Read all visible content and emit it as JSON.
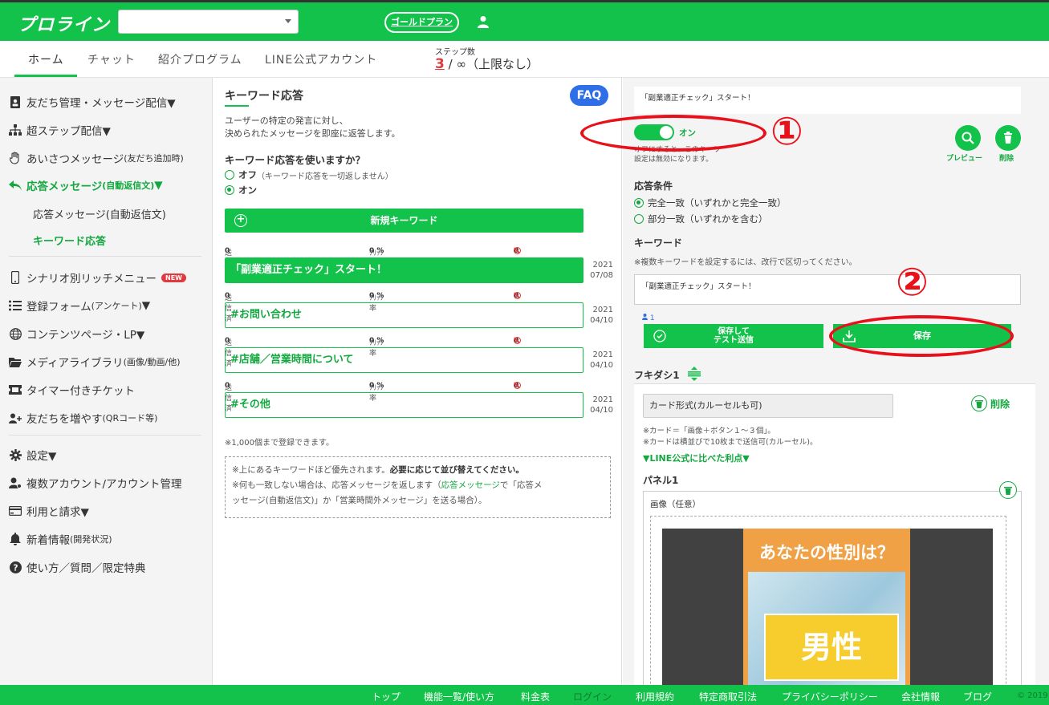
{
  "header": {
    "logo": "プロライン",
    "account_select_value": "",
    "plan_badge": "ゴールドプラン",
    "user_icon": "user-icon"
  },
  "nav": {
    "tabs": [
      "ホーム",
      "チャット",
      "紹介プログラム",
      "LINE公式アカウント"
    ],
    "active_tab": "ホーム",
    "steps_label": "ステップ数",
    "steps_current": "3",
    "steps_rest": "/ ∞（上限なし）"
  },
  "sidebar": {
    "items": [
      {
        "label": "友だち管理・メッセージ配信▼",
        "icon": "address-book-icon"
      },
      {
        "label": "超ステップ配信▼",
        "icon": "sitemap-icon"
      },
      {
        "label": "あいさつメッセージ",
        "small": "(友だち追加時)",
        "icon": "hand-icon"
      },
      {
        "label": "応答メッセージ",
        "small": "(自動返信文)",
        "suffix": "▼",
        "icon": "reply-icon"
      },
      {
        "label": "シナリオ別リッチメニュー",
        "badge": "NEW",
        "icon": "phone-icon"
      },
      {
        "label": "登録フォーム",
        "small": "(アンケート)",
        "suffix": "▼",
        "icon": "list-icon"
      },
      {
        "label": "コンテンツページ・LP▼",
        "icon": "globe-icon"
      },
      {
        "label": "メディアライブラリ",
        "small": "(画像/動画/他)",
        "icon": "folder-icon"
      },
      {
        "label": "タイマー付きチケット",
        "icon": "ticket-icon"
      },
      {
        "label": "友だちを増やす",
        "small": "(QRコード等)",
        "icon": "user-plus-icon"
      },
      {
        "label": "設定▼",
        "icon": "gear-icon"
      },
      {
        "label": "複数アカウント/アカウント管理",
        "icon": "users-cog-icon"
      },
      {
        "label": "利用と請求▼",
        "icon": "credit-card-icon"
      },
      {
        "label": "新着情報",
        "small": "(開発状況)",
        "icon": "bell-icon"
      },
      {
        "label": "使い方／質問／限定特典",
        "icon": "question-icon"
      }
    ],
    "sub_items": [
      "応答メッセージ(自動返信文)",
      "キーワード応答"
    ]
  },
  "middle": {
    "title": "キーワード応答",
    "faq": "FAQ",
    "desc_line1": "ユーザーの特定の発言に対し、",
    "desc_line2": "決められたメッセージを即座に返答します。",
    "question": "キーワード応答を使いますか？",
    "option_off": "オフ",
    "option_off_note": "（キーワード応答を一切返しません）",
    "option_on": "オン",
    "new_keyword_button": "新規キーワード",
    "keywords": [
      {
        "sent_label": "送信済",
        "sent": "0",
        "click_label": "ｸﾘｯｸ率",
        "click": "0 %",
        "blocked": "0",
        "name": "「副業適正チェック」スタート！",
        "year": "2021",
        "date": "07/08"
      },
      {
        "sent_label": "送信済",
        "sent": "0",
        "click_label": "ｸﾘｯｸ率",
        "click": "0 %",
        "blocked": "0",
        "name": "#お問い合わせ",
        "year": "2021",
        "date": "04/10"
      },
      {
        "sent_label": "送信済",
        "sent": "0",
        "click_label": "ｸﾘｯｸ率",
        "click": "0 %",
        "blocked": "0",
        "name": "#店舗／営業時間について",
        "year": "2021",
        "date": "04/10"
      },
      {
        "sent_label": "送信済",
        "sent": "0",
        "click_label": "ｸﾘｯｸ率",
        "click": "0 %",
        "blocked": "0",
        "name": "#その他",
        "year": "2021",
        "date": "04/10"
      }
    ],
    "limit_note": "※1,000個まで登録できます。",
    "tip1_a": "※上にあるキーワードほど優先されます。",
    "tip1_b": "必要に応じて並び替えてください。",
    "tip2_a": "※何も一致しない場合は、応答メッセージを返します（",
    "tip2_link": "応答メッセージ",
    "tip2_b": "で「応答メ",
    "tip2_c": "ッセージ(自動返信文)」か「営業時間外メッセージ」を送る場合）。"
  },
  "editor": {
    "title_value": "「副業適正チェック」スタート！",
    "toggle_label": "オン",
    "off_note_line1": "オフにすると、このキーワ",
    "off_note_line2": "設定は無効になります。",
    "preview_label": "プレビュー",
    "delete_label": "削除",
    "condition_heading": "応答条件",
    "condition_exact": "完全一致（いずれかと完全一致）",
    "condition_partial": "部分一致（いずれかを含む）",
    "keyword_heading": "キーワード",
    "keyword_note": "※複数キーワードを設定するには、改行で区切ってください。",
    "keyword_value": "「副業適正チェック」スタート！",
    "users_count": "1",
    "save_test_line1": "保存して",
    "save_test_line2": "テスト送信",
    "save_label": "保存",
    "fukidashi_label": "フキダシ1",
    "message_type_value": "カード形式(カルーセルも可)",
    "card_delete_label": "削除",
    "card_note_line1": "※カード＝「画像＋ボタン１～３個」。",
    "card_note_line2": "※カードは横並びで10枚まで送信可(カルーセル)。",
    "advantage_link": "▼LINE公式に比べた利点▼",
    "panel_heading": "パネル1",
    "image_label": "画像（任意）",
    "image_question": "あなたの性別は？",
    "image_sign": "男性"
  },
  "annotations": {
    "num1": "①",
    "num2": "②",
    "color": "#e8101a"
  },
  "footer": {
    "links": [
      "トップ",
      "機能一覧/使い方",
      "料金表",
      "ログイン",
      "利用規約",
      "特定商取引法",
      "プライバシーポリシー",
      "会社情報",
      "ブログ"
    ],
    "copyright": "© 2019"
  },
  "colors": {
    "brand_green": "#13c24a",
    "accent_blue": "#2e6ee6",
    "accent_red": "#e0393e"
  }
}
